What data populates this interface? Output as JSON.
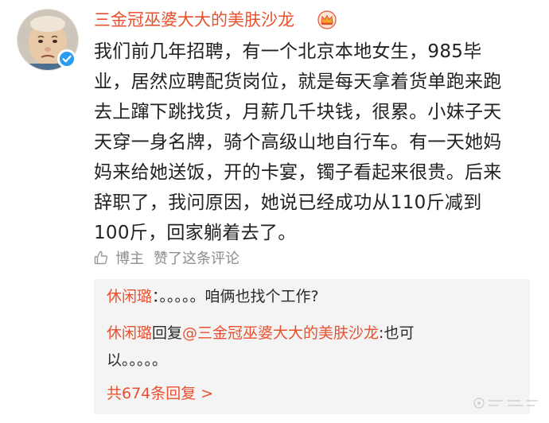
{
  "user": {
    "name": "三金冠巫婆大大的美肤沙龙"
  },
  "post": {
    "lines": [
      "我们前几年招聘，有一个北京本地女生，985毕",
      "业，居然应聘配货岗位，就是每天拿着货单跑来跑",
      "去上蹿下跳找货，月薪几千块钱，很累。小妹子天",
      "天穿一身名牌，骑个高级山地自行车。有一天她妈",
      "妈来给她送饭，开的卡宴，镯子看起来很贵。后来",
      "辞职了，我问原因，她说已经成功从110斤减到",
      "100斤，回家躺着去了。"
    ]
  },
  "like": {
    "who": "博主",
    "action": "赞了这条评论"
  },
  "replies": [
    {
      "nick": "休闲璐",
      "separator": "：",
      "text": "。。。。。咱俩也找个工作?"
    },
    {
      "nick": "休闲璐",
      "verb": "回复",
      "mention": "@三金冠巫婆大大的美肤沙龙",
      "colon": ":",
      "text_line1": "也可",
      "text_line2": "以。。。。。"
    }
  ],
  "more_replies": "共674条回复 >",
  "icons": {
    "avatar": "avatar-portrait-icon",
    "verified": "verified-badge-icon",
    "crown": "crown-icon",
    "like": "thumbs-up-icon"
  },
  "colors": {
    "accent": "#e8512f",
    "verified": "#2c9cf0",
    "muted": "#8c8c8c",
    "reply_bg": "#f4f4f4"
  }
}
